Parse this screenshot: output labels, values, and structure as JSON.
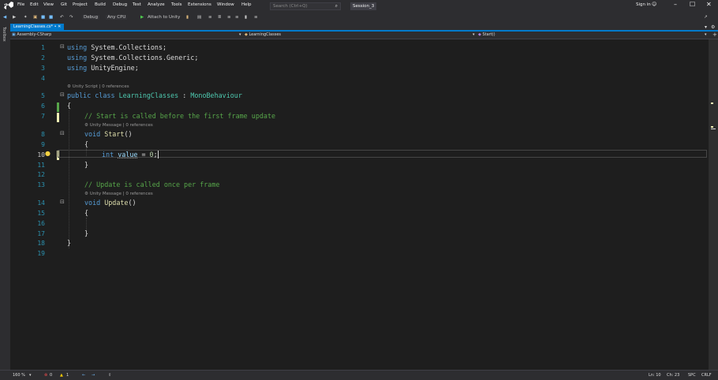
{
  "menubar": {
    "items": [
      "File",
      "Edit",
      "View",
      "Git",
      "Project",
      "Build",
      "Debug",
      "Test",
      "Analyze",
      "Tools",
      "Extensions",
      "Window",
      "Help"
    ],
    "search_placeholder": "Search (Ctrl+Q)",
    "session": "Session_3",
    "signin": "Sign in",
    "accent": "#007acc"
  },
  "toolbar": {
    "configuration": "Debug",
    "platform": "Any CPU",
    "attach": "Attach to Unity"
  },
  "left_strip": {
    "label": "Toolbox"
  },
  "tabs": [
    {
      "label": "LearningClasses.cs*"
    }
  ],
  "navbar": {
    "project": "Assembly-CSharp",
    "class": "LearningClasses",
    "member": "Start()"
  },
  "editor": {
    "line_numbers": [
      "1",
      "2",
      "3",
      "4",
      "5",
      "6",
      "7",
      "8",
      "9",
      "10",
      "11",
      "12",
      "13",
      "14",
      "15",
      "16",
      "17",
      "18",
      "19"
    ],
    "lens_unity_script": "Unity Script | 0 references",
    "lens_unity_message_1": "Unity Message | 0 references",
    "lens_unity_message_2": "Unity Message | 0 references",
    "code": {
      "l1_kw": "using",
      "l1_rest": " System.Collections;",
      "l2_kw": "using",
      "l2_rest": " System.Collections.Generic;",
      "l3_kw": "using",
      "l3_rest": " UnityEngine;",
      "l5_kw1": "public",
      "l5_kw2": " class ",
      "l5_name": "LearningClasses",
      "l5_colon": " : ",
      "l5_base": "MonoBehaviour",
      "l6": "{",
      "l7": "// Start is called before the first frame update",
      "l8_kw": "void",
      "l8_sp": " ",
      "l8_fn": "Start",
      "l8_paren": "()",
      "l9": "{",
      "l10_kw": "int",
      "l10_sp": " ",
      "l10_id": "value",
      "l10_eq": " = ",
      "l10_num": "0",
      "l10_semi": ";",
      "l11": "}",
      "l13": "// Update is called once per frame",
      "l14_kw": "void",
      "l14_sp": " ",
      "l14_fn": "Update",
      "l14_paren": "()",
      "l15": "{",
      "l17": "}",
      "l18": "}"
    }
  },
  "status": {
    "zoom": "160 %",
    "errors": "0",
    "warnings": "1",
    "line": "Ln: 10",
    "col": "Ch: 23",
    "indent": "SPC",
    "eol": "CRLF"
  }
}
